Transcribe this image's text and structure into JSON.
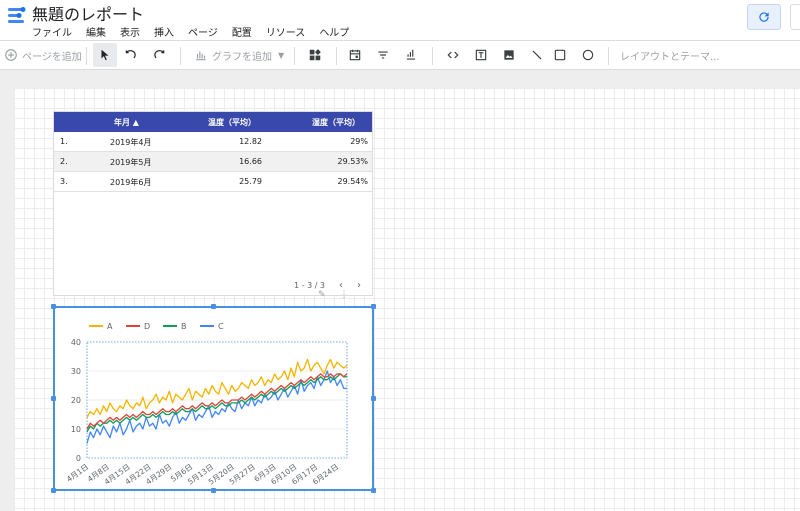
{
  "header": {
    "title": "無題のレポート",
    "menu": [
      "ファイル",
      "編集",
      "表示",
      "挿入",
      "ページ",
      "配置",
      "リソース",
      "ヘルプ"
    ]
  },
  "toolbar": {
    "add_page": "ページを追加",
    "add_chart": "グラフを追加",
    "layout_theme": "レイアウトとテーマ..."
  },
  "table": {
    "headers": [
      "年月 ▲",
      "温度（平均）",
      "湿度（平均）"
    ],
    "rows": [
      {
        "idx": "1.",
        "month": "2019年4月",
        "temp": "12.82",
        "hum": "29%"
      },
      {
        "idx": "2.",
        "month": "2019年5月",
        "temp": "16.66",
        "hum": "29.53%"
      },
      {
        "idx": "3.",
        "month": "2019年6月",
        "temp": "25.79",
        "hum": "29.54%"
      }
    ],
    "pager": "1 - 3 / 3"
  },
  "chart_data": {
    "type": "line",
    "legend": [
      "A",
      "D",
      "B",
      "C"
    ],
    "colors": {
      "A": "#f4b400",
      "D": "#db4437",
      "B": "#0f9d58",
      "C": "#4285f4"
    },
    "legend_position": "top-left",
    "ylim": [
      0,
      40
    ],
    "yticks": [
      "0",
      "10",
      "20",
      "30",
      "40"
    ],
    "xticks": [
      "4月1日",
      "4月8日",
      "4月15日",
      "4月22日",
      "4月29日",
      "5月6日",
      "5月13日",
      "5月20日",
      "5月27日",
      "6月3日",
      "6月10日",
      "6月17日",
      "6月24日"
    ],
    "series": [
      {
        "name": "A",
        "values": [
          14,
          16,
          15,
          17,
          15,
          18,
          16,
          19,
          17,
          16,
          18,
          17,
          20,
          18,
          17,
          19,
          18,
          21,
          17,
          19,
          20,
          22,
          19,
          21,
          20,
          23,
          19,
          22,
          21,
          20,
          22,
          24,
          20,
          23,
          22,
          21,
          24,
          22,
          25,
          23,
          22,
          26,
          24,
          22,
          25,
          23,
          24,
          26,
          25,
          24,
          27,
          25,
          26,
          28,
          25,
          27,
          26,
          29,
          27,
          28,
          30,
          27,
          31,
          28,
          33,
          30,
          31,
          34,
          30,
          32,
          33,
          31,
          29,
          32,
          34,
          31,
          33,
          32,
          31,
          32
        ]
      },
      {
        "name": "D",
        "values": [
          10,
          12,
          11,
          12,
          13,
          12,
          13,
          14,
          13,
          14,
          13,
          14,
          15,
          14,
          15,
          14,
          15,
          16,
          15,
          15,
          16,
          15,
          16,
          17,
          16,
          16,
          17,
          16,
          17,
          18,
          17,
          17,
          18,
          17,
          18,
          19,
          18,
          18,
          19,
          18,
          19,
          20,
          19,
          19,
          20,
          20,
          20,
          21,
          20,
          21,
          22,
          21,
          22,
          23,
          22,
          23,
          24,
          23,
          24,
          25,
          24,
          25,
          26,
          25,
          26,
          27,
          26,
          27,
          28,
          27,
          28,
          29,
          28,
          28,
          29,
          28,
          29,
          29,
          28,
          29
        ]
      },
      {
        "name": "B",
        "values": [
          9,
          11,
          10,
          12,
          11,
          12,
          12,
          13,
          12,
          13,
          12,
          13,
          14,
          13,
          14,
          13,
          14,
          15,
          14,
          14,
          15,
          14,
          15,
          16,
          15,
          15,
          16,
          15,
          16,
          17,
          16,
          16,
          17,
          16,
          17,
          18,
          17,
          17,
          18,
          17,
          18,
          19,
          18,
          18,
          19,
          19,
          19,
          20,
          19,
          20,
          21,
          20,
          21,
          22,
          21,
          22,
          23,
          22,
          23,
          24,
          23,
          24,
          25,
          24,
          25,
          26,
          25,
          26,
          27,
          26,
          27,
          28,
          27,
          27,
          28,
          27,
          28,
          29,
          28,
          28
        ]
      },
      {
        "name": "C",
        "values": [
          5,
          9,
          7,
          10,
          8,
          11,
          9,
          7,
          11,
          9,
          12,
          8,
          10,
          13,
          9,
          11,
          12,
          10,
          14,
          11,
          12,
          10,
          15,
          12,
          13,
          11,
          14,
          16,
          12,
          14,
          13,
          15,
          17,
          13,
          15,
          14,
          16,
          18,
          14,
          16,
          15,
          17,
          16,
          19,
          17,
          16,
          20,
          17,
          19,
          18,
          21,
          18,
          20,
          19,
          22,
          20,
          21,
          23,
          20,
          22,
          24,
          21,
          23,
          25,
          22,
          27,
          23,
          25,
          26,
          24,
          28,
          25,
          27,
          30,
          26,
          28,
          25,
          27,
          24,
          24
        ]
      }
    ]
  }
}
